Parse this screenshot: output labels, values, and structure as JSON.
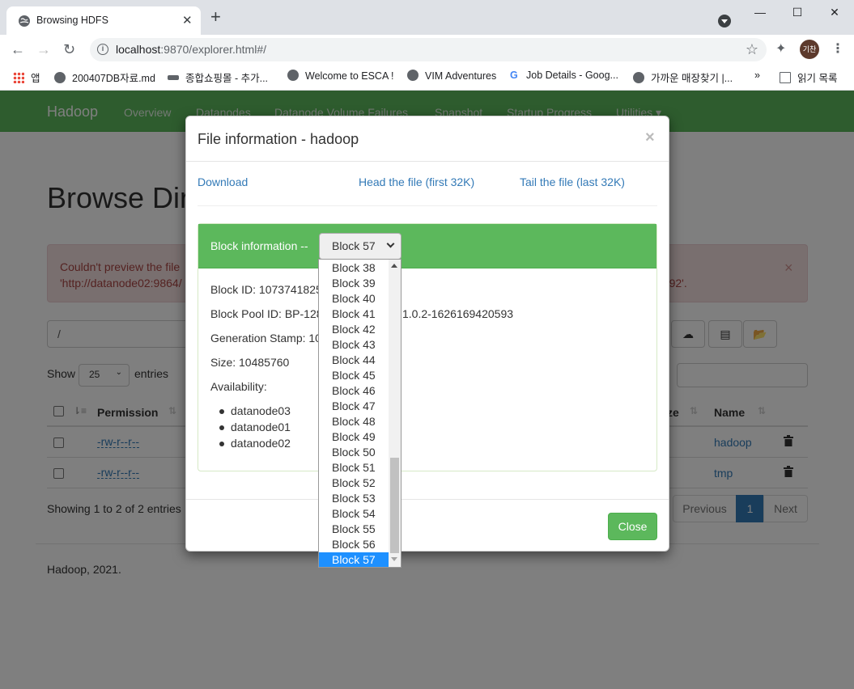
{
  "browser": {
    "tab_title": "Browsing HDFS",
    "url_host": "localhost",
    "url_rest": ":9870/explorer.html#/",
    "avatar_text": "기찬",
    "bookmarks": [
      "앱",
      "200407DB자료.md",
      "종합쇼핑몰 - 추가...",
      "Welcome to ESCA !",
      "VIM Adventures",
      "Job Details - Goog...",
      "가까운 매장찾기 |...",
      "»",
      "읽기 목록"
    ]
  },
  "navbar": {
    "brand": "Hadoop",
    "links": [
      "Overview",
      "Datanodes",
      "Datanode Volume Failures",
      "Snapshot",
      "Startup Progress",
      "Utilities ▾"
    ]
  },
  "page": {
    "title": "Browse Dir",
    "alert_line1": "Couldn't preview the file",
    "alert_line2": "'http://datanode02:9864/",
    "alert_line2_end": "3392'.",
    "alert_close": "×",
    "path_value": "/",
    "show_label": "Show",
    "entries_value": "25",
    "entries_label": "entries",
    "search_label": ":",
    "columns": {
      "permission": "Permission",
      "size": "ze",
      "name": "Name"
    },
    "rows": [
      {
        "permission": "-rw-r--r--",
        "name": "hadoop"
      },
      {
        "permission": "-rw-r--r--",
        "name": "tmp"
      }
    ],
    "showing": "Showing 1 to 2 of 2 entries",
    "pager": {
      "previous": "Previous",
      "current": "1",
      "next": "Next"
    },
    "footer": "Hadoop, 2021."
  },
  "modal": {
    "title": "File information - hadoop",
    "close_x": "×",
    "download": "Download",
    "head": "Head the file (first 32K)",
    "tail": "Tail the file (last 32K)",
    "block_info_label": "Block information --",
    "selected_block": "Block 57",
    "block_id": "Block ID: 1073741825",
    "block_pool": "Block Pool ID: BP-128",
    "block_pool_end": "1.0.2-1626169420593",
    "generation_stamp": "Generation Stamp: 10",
    "size": "Size: 10485760",
    "availability": "Availability:",
    "datanodes": [
      "datanode03",
      "datanode01",
      "datanode02"
    ],
    "close_button": "Close",
    "dropdown_options": [
      "Block 38",
      "Block 39",
      "Block 40",
      "Block 41",
      "Block 42",
      "Block 43",
      "Block 44",
      "Block 45",
      "Block 46",
      "Block 47",
      "Block 48",
      "Block 49",
      "Block 50",
      "Block 51",
      "Block 52",
      "Block 53",
      "Block 54",
      "Block 55",
      "Block 56",
      "Block 57"
    ]
  }
}
